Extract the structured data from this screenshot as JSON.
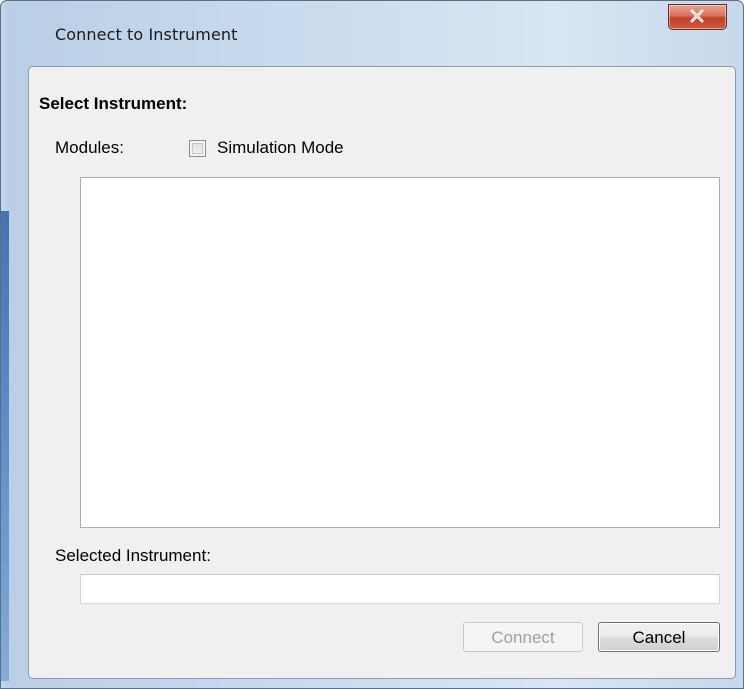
{
  "window": {
    "title": "Connect to Instrument",
    "close_icon": "close-icon"
  },
  "dialog": {
    "heading": "Select Instrument:",
    "modules_label": "Modules:",
    "simulation_mode": {
      "label": "Simulation Mode",
      "checked": false
    },
    "modules_list": [],
    "selected_instrument_label": "Selected Instrument:",
    "selected_instrument_value": "",
    "buttons": {
      "connect": "Connect",
      "connect_enabled": false,
      "cancel": "Cancel"
    }
  }
}
